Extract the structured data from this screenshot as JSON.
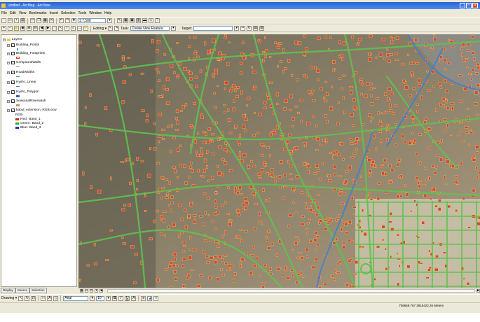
{
  "window": {
    "title": "Untitled - ArcMap - ArcView"
  },
  "menu": [
    "File",
    "Edit",
    "View",
    "Bookmarks",
    "Insert",
    "Selection",
    "Tools",
    "Window",
    "Help"
  ],
  "toolbar": {
    "scale": "1:7,500",
    "editor": "Editing ▾",
    "task_label": "Task:",
    "task_value": "Create New Feature",
    "target_label": "Target:",
    "target_value": ""
  },
  "toc": {
    "root": "Layers",
    "layers": [
      {
        "name": "Building_Points",
        "symbol": "point",
        "color": "#2b9ad6"
      },
      {
        "name": "Building_Footprints",
        "symbol": "poly",
        "color": "#e43b2d"
      },
      {
        "name": "CompoundWalls",
        "symbol": "line",
        "color": "#8a8a8a"
      },
      {
        "name": "RoadWidths",
        "symbol": "line",
        "color": "#4a9a4a"
      },
      {
        "name": "Hydro_Linear",
        "symbol": "line",
        "color": "#3f7fd0"
      },
      {
        "name": "Hydro_Polygon",
        "symbol": "poly",
        "color": "#2e63c0"
      },
      {
        "name": "SeasonalRiverwash",
        "symbol": "poly",
        "color": "#a89b7e"
      },
      {
        "name": "kabul_extension_RGB.ecw",
        "symbol": "raster",
        "color": ""
      }
    ],
    "raster_label": "RGB",
    "bands": [
      {
        "channel": "Red:",
        "band": "Band_1",
        "color": "#e02020"
      },
      {
        "channel": "Green:",
        "band": "Band_2",
        "color": "#20b020"
      },
      {
        "channel": "Blue:",
        "band": "Band_3",
        "color": "#2030c0"
      }
    ],
    "tabs": [
      "Display",
      "Source",
      "Selection"
    ]
  },
  "drawing": {
    "label": "Drawing ▾",
    "font": "Arial",
    "size": "10",
    "bold": "B",
    "italic": "I",
    "underline": "U",
    "font_color": "A"
  },
  "status": {
    "coordinates": "706659.767 3818422.26 Meters"
  },
  "colors": {
    "titlebar": "#2b63d3",
    "chrome": "#ece9d8",
    "building": "#d2483a",
    "road": "#5fc24f",
    "river": "#3f7fd0"
  }
}
